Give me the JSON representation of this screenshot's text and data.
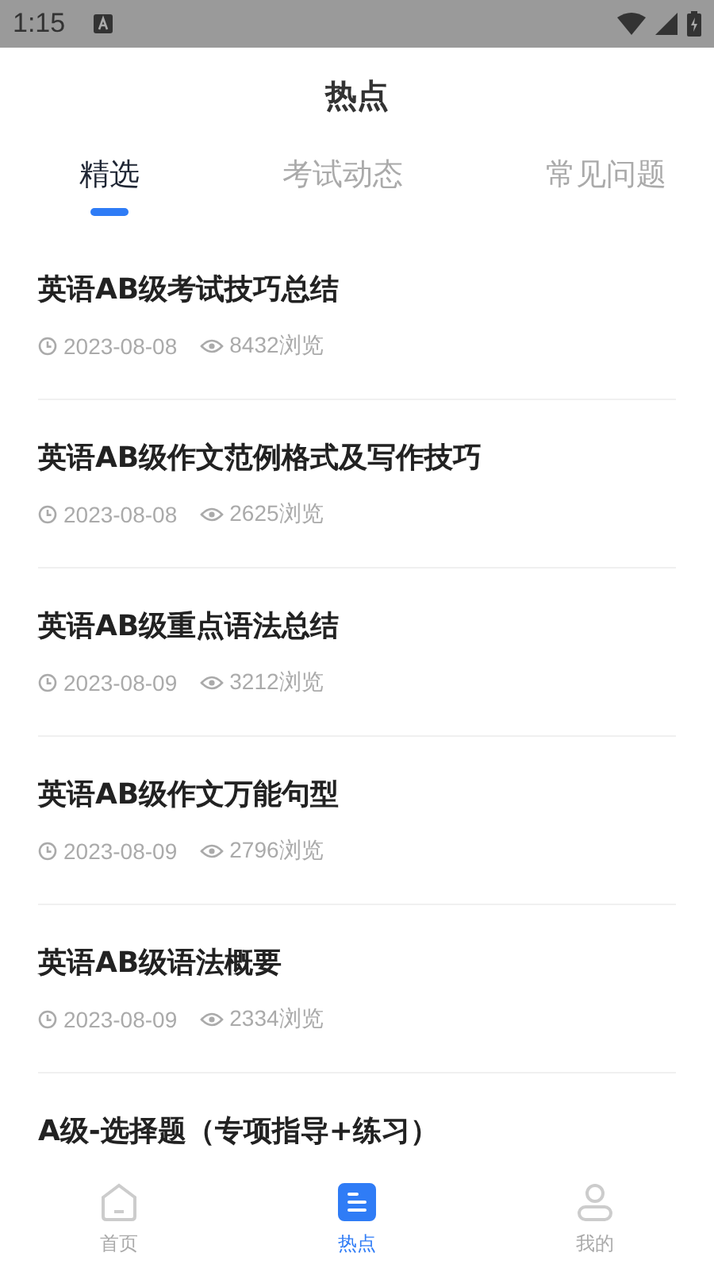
{
  "status_bar": {
    "time": "1:15"
  },
  "header": {
    "title": "热点"
  },
  "tabs": [
    {
      "label": "精选",
      "selected": true
    },
    {
      "label": "考试动态",
      "selected": false
    },
    {
      "label": "常见问题",
      "selected": false
    }
  ],
  "articles": [
    {
      "title": "英语AB级考试技巧总结",
      "date": "2023-08-08",
      "views": "8432浏览"
    },
    {
      "title": "英语AB级作文范例格式及写作技巧",
      "date": "2023-08-08",
      "views": "2625浏览"
    },
    {
      "title": "英语AB级重点语法总结",
      "date": "2023-08-09",
      "views": "3212浏览"
    },
    {
      "title": "英语AB级作文万能句型",
      "date": "2023-08-09",
      "views": "2796浏览"
    },
    {
      "title": "英语AB级语法概要",
      "date": "2023-08-09",
      "views": "2334浏览"
    },
    {
      "title": "A级-选择题（专项指导+练习）"
    }
  ],
  "bottom_nav": [
    {
      "label": "首页",
      "kind": "home",
      "selected": false
    },
    {
      "label": "热点",
      "kind": "hot",
      "selected": true
    },
    {
      "label": "我的",
      "kind": "profile",
      "selected": false
    }
  ]
}
